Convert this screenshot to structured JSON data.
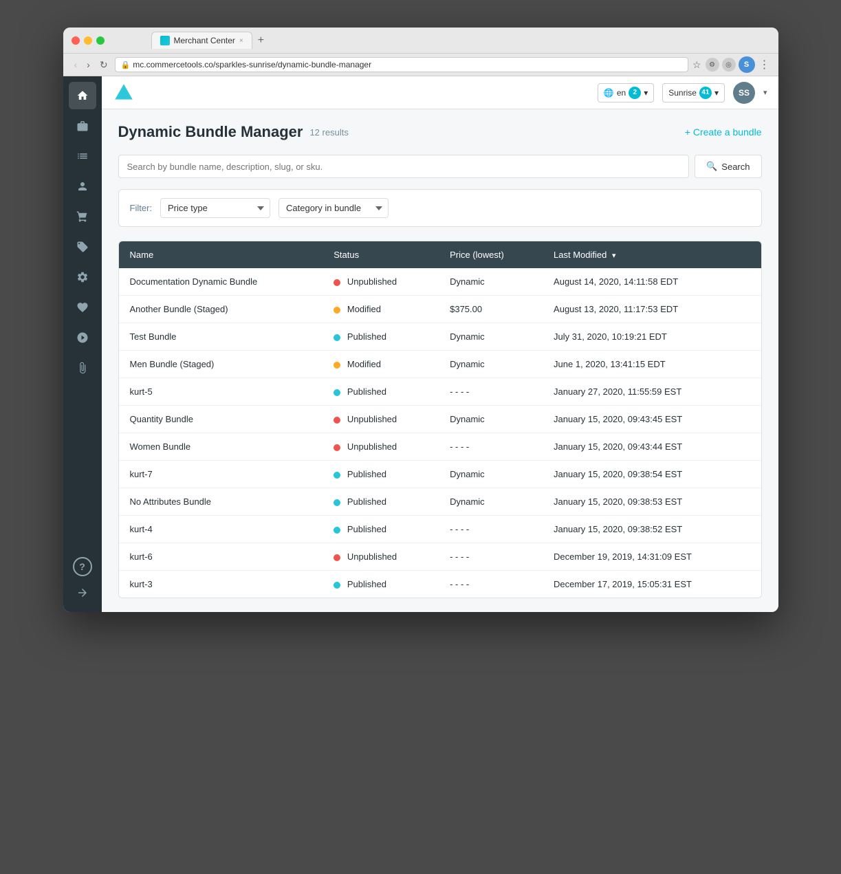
{
  "window": {
    "title": "Merchant Center",
    "url": "mc.commercetools.co/sparkles-sunrise/dynamic-bundle-manager",
    "tab_close": "×",
    "tab_new": "+"
  },
  "header": {
    "lang": "en",
    "lang_badge": "2",
    "store": "Sunrise",
    "store_badge": "41",
    "user_initials": "SS"
  },
  "page": {
    "title": "Dynamic Bundle Manager",
    "results": "12 results",
    "create_btn": "+ Create a bundle"
  },
  "search": {
    "placeholder": "Search by bundle name, description, slug, or sku.",
    "btn_label": "Search"
  },
  "filters": {
    "label": "Filter:",
    "price_type_placeholder": "Price type",
    "category_placeholder": "Category in bundle"
  },
  "table": {
    "columns": [
      "Name",
      "Status",
      "Price (lowest)",
      "Last Modified"
    ],
    "rows": [
      {
        "name": "Documentation Dynamic Bundle",
        "status": "Unpublished",
        "status_type": "unpublished",
        "price": "Dynamic",
        "last_modified": "August 14, 2020, 14:11:58 EDT"
      },
      {
        "name": "Another Bundle (Staged)",
        "status": "Modified",
        "status_type": "modified",
        "price": "$375.00",
        "last_modified": "August 13, 2020, 11:17:53 EDT"
      },
      {
        "name": "Test Bundle",
        "status": "Published",
        "status_type": "published",
        "price": "Dynamic",
        "last_modified": "July 31, 2020, 10:19:21 EDT"
      },
      {
        "name": "Men Bundle (Staged)",
        "status": "Modified",
        "status_type": "modified",
        "price": "Dynamic",
        "last_modified": "June 1, 2020, 13:41:15 EDT"
      },
      {
        "name": "kurt-5",
        "status": "Published",
        "status_type": "published",
        "price": "- - - -",
        "last_modified": "January 27, 2020, 11:55:59 EST"
      },
      {
        "name": "Quantity Bundle",
        "status": "Unpublished",
        "status_type": "unpublished",
        "price": "Dynamic",
        "last_modified": "January 15, 2020, 09:43:45 EST"
      },
      {
        "name": "Women Bundle",
        "status": "Unpublished",
        "status_type": "unpublished",
        "price": "- - - -",
        "last_modified": "January 15, 2020, 09:43:44 EST"
      },
      {
        "name": "kurt-7",
        "status": "Published",
        "status_type": "published",
        "price": "Dynamic",
        "last_modified": "January 15, 2020, 09:38:54 EST"
      },
      {
        "name": "No Attributes Bundle",
        "status": "Published",
        "status_type": "published",
        "price": "Dynamic",
        "last_modified": "January 15, 2020, 09:38:53 EST"
      },
      {
        "name": "kurt-4",
        "status": "Published",
        "status_type": "published",
        "price": "- - - -",
        "last_modified": "January 15, 2020, 09:38:52 EST"
      },
      {
        "name": "kurt-6",
        "status": "Unpublished",
        "status_type": "unpublished",
        "price": "- - - -",
        "last_modified": "December 19, 2019, 14:31:09 EST"
      },
      {
        "name": "kurt-3",
        "status": "Published",
        "status_type": "published",
        "price": "- - - -",
        "last_modified": "December 17, 2019, 15:05:31 EST"
      }
    ]
  },
  "sidebar": {
    "items": [
      {
        "icon": "🏠",
        "name": "home",
        "label": "Home"
      },
      {
        "icon": "📦",
        "name": "products",
        "label": "Products"
      },
      {
        "icon": "📊",
        "name": "categories",
        "label": "Categories"
      },
      {
        "icon": "👤",
        "name": "customers",
        "label": "Customers"
      },
      {
        "icon": "🛒",
        "name": "orders",
        "label": "Orders"
      },
      {
        "icon": "🏷️",
        "name": "discounts",
        "label": "Discounts"
      },
      {
        "icon": "⚙️",
        "name": "settings",
        "label": "Settings"
      },
      {
        "icon": "♡",
        "name": "wishlist",
        "label": "Wishlist"
      },
      {
        "icon": "🚀",
        "name": "extensions",
        "label": "Extensions"
      },
      {
        "icon": "📎",
        "name": "attachments",
        "label": "Attachments"
      }
    ],
    "bottom": [
      {
        "icon": "?",
        "name": "help",
        "label": "Help"
      },
      {
        "icon": "→",
        "name": "logout",
        "label": "Logout"
      }
    ]
  }
}
